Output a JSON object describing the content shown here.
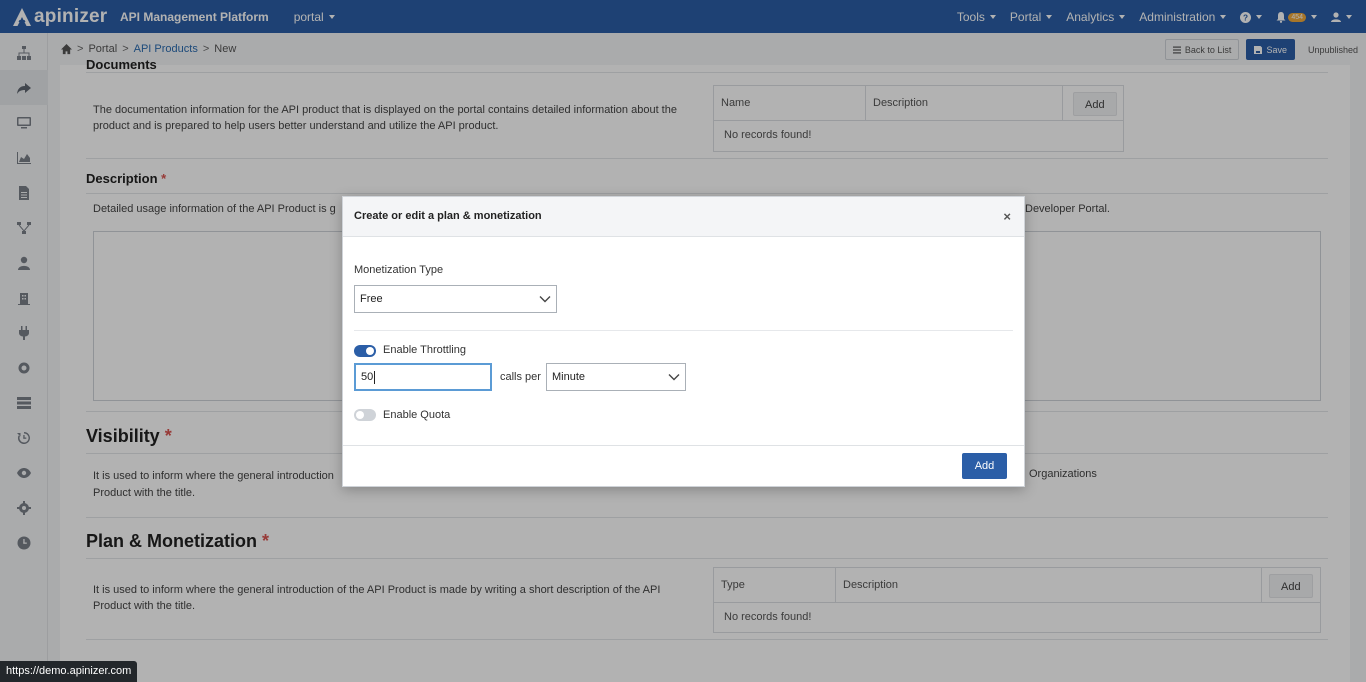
{
  "app": {
    "brand": "apinizer",
    "platform": "API Management Platform",
    "workspace": "portal"
  },
  "nav": {
    "tools": "Tools",
    "portal": "Portal",
    "analytics": "Analytics",
    "administration": "Administration",
    "notif_count": "454"
  },
  "breadcrumb": {
    "items": [
      "Portal",
      "API Products",
      "New"
    ]
  },
  "actions": {
    "back": "Back to List",
    "save": "Save",
    "status": "Unpublished"
  },
  "documents": {
    "title": "Documents",
    "text": "The documentation information for the API product that is displayed on the portal contains detailed information about the product and is prepared to help users better understand and utilize the API product.",
    "col_name": "Name",
    "col_desc": "Description",
    "add": "Add",
    "empty": "No records found!"
  },
  "description": {
    "title": "Description",
    "text_left": "Detailed usage information of the API Product is g",
    "text_right": "Developer Portal."
  },
  "visibility": {
    "title": "Visibility",
    "text_line1": "It is used to inform where the general introduction",
    "text_line2": "Product with the title.",
    "right_label": "Organizations"
  },
  "plan": {
    "title": "Plan & Monetization",
    "text": "It is used to inform where the general introduction of the API Product is made by writing a short description of the API Product with the title.",
    "col_type": "Type",
    "col_desc": "Description",
    "add": "Add",
    "empty": "No records found!"
  },
  "modal": {
    "title": "Create or edit a plan & monetization",
    "close": "×",
    "monetization_label": "Monetization Type",
    "monetization_value": "Free",
    "throttling_label": "Enable Throttling",
    "throttling_on": true,
    "calls_value": "50",
    "calls_per": "calls per",
    "period_value": "Minute",
    "quota_label": "Enable Quota",
    "quota_on": false,
    "add": "Add"
  },
  "status_url": "https://demo.apinizer.com",
  "colors": {
    "primary": "#2b5ea7",
    "required": "#d9534f",
    "badge": "#f0a93b"
  }
}
